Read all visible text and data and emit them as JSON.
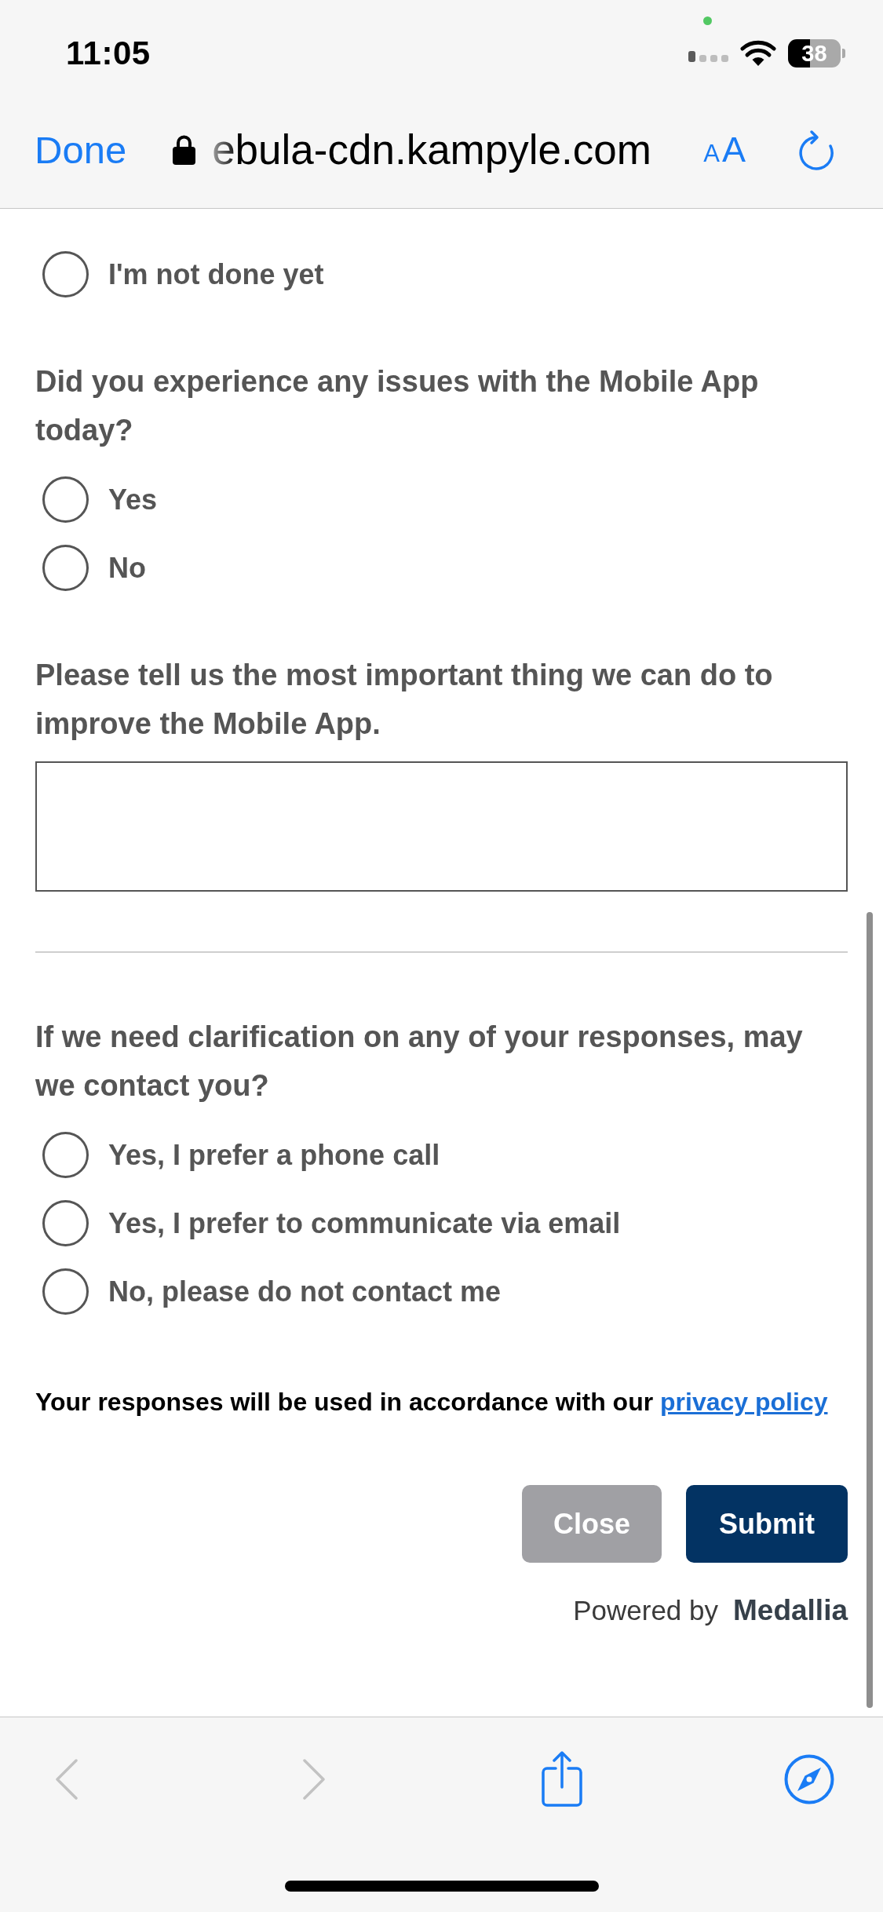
{
  "status_bar": {
    "time": "11:05",
    "battery": "38"
  },
  "address_bar": {
    "done": "Done",
    "url": "ebula-cdn.kampyle.com",
    "text_size": "AA"
  },
  "form": {
    "items": [
      {
        "kind": "choice",
        "options": [
          {
            "label": "I'm not done yet",
            "selected": false
          }
        ]
      },
      {
        "kind": "choice",
        "prompt": "Did you experience any issues with the Mobile App today?",
        "options": [
          {
            "label": "Yes",
            "selected": false
          },
          {
            "label": "No",
            "selected": false
          }
        ]
      },
      {
        "kind": "text",
        "prompt": "Please tell us the most important thing we can do to improve the Mobile App."
      },
      {
        "kind": "divider"
      },
      {
        "kind": "choice",
        "prompt": "If we need clarification on any of your responses, may we contact you?",
        "options": [
          {
            "label": "Yes, I prefer a phone call",
            "selected": false
          },
          {
            "label": "Yes, I prefer to communicate via email",
            "selected": false
          },
          {
            "label": "No, please do not contact me",
            "selected": false
          }
        ]
      }
    ],
    "notice": {
      "text": "Your responses will be used in accordance with our",
      "link": "privacy policy"
    },
    "buttons": [
      {
        "label": "Close",
        "kind": "secondary"
      },
      {
        "label": "Submit",
        "kind": "primary"
      }
    ],
    "powered_by": {
      "label": "Powered by",
      "brand": "Medallia"
    }
  },
  "toolbar": {
    "back": {
      "disabled": true
    },
    "forward": {
      "disabled": true
    }
  }
}
